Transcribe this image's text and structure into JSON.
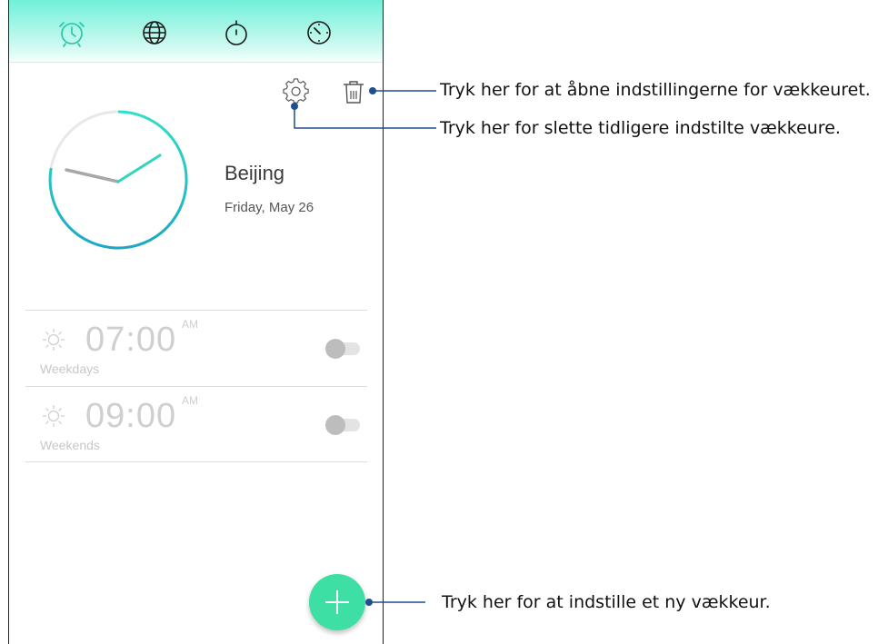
{
  "tabs": [
    {
      "name": "alarm-clock-icon",
      "active": true
    },
    {
      "name": "globe-icon",
      "active": false
    },
    {
      "name": "stopwatch-icon",
      "active": false
    },
    {
      "name": "timer-icon",
      "active": false
    }
  ],
  "world_clock": {
    "city": "Beijing",
    "date": "Friday, May 26"
  },
  "alarms": [
    {
      "time": "07:00",
      "period": "AM",
      "days": "Weekdays",
      "enabled": false
    },
    {
      "time": "09:00",
      "period": "AM",
      "days": "Weekends",
      "enabled": false
    }
  ],
  "callouts": {
    "settings": "Tryk her for at åbne indstillingerne for vækkeuret.",
    "delete": "Tryk her for slette tidligere indstilte vækkeure.",
    "add": "Tryk her for at indstille et ny vækkeur."
  },
  "colors": {
    "accent": "#2ed7bd",
    "fab": "#3edfa5",
    "callout_line": "#1f4f8c",
    "clock_ring_start": "#2fe0c6",
    "clock_ring_end": "#1ba8c7"
  }
}
